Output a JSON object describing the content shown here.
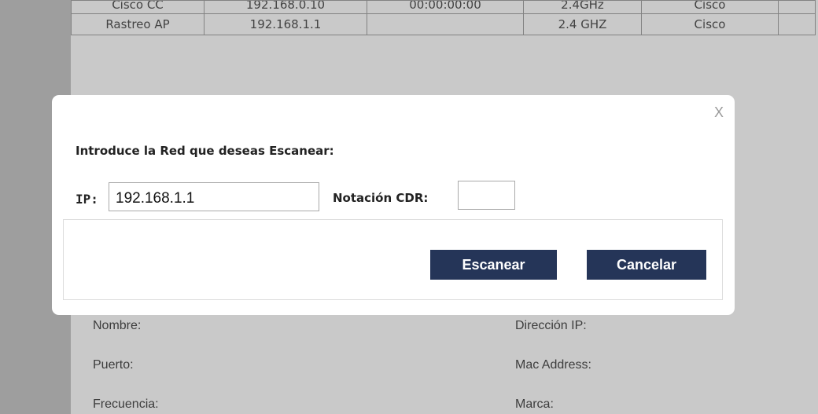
{
  "table": {
    "rows": [
      {
        "name": "Cisco CC",
        "ip": "192.168.0.10",
        "mac": "00:00:00:00",
        "freq": "2.4GHz",
        "brand": "Cisco",
        "extra": ""
      },
      {
        "name": "Rastreo AP",
        "ip": "192.168.1.1",
        "mac": "",
        "freq": "2.4 GHZ",
        "brand": "Cisco",
        "extra": ""
      }
    ]
  },
  "details": {
    "name_label": "Nombre:",
    "port_label": "Puerto:",
    "freq_label": "Frecuencia:",
    "ip_label": "Dirección IP:",
    "mac_label": "Mac Address:",
    "brand_label": "Marca:"
  },
  "modal": {
    "close_label": "X",
    "title": "Introduce la Red que deseas Escanear:",
    "ip_label": "IP:",
    "ip_value": "192.168.1.1",
    "cdr_label": "Notación CDR:",
    "cdr_value": "",
    "scan_button": "Escanear",
    "cancel_button": "Cancelar"
  },
  "colors": {
    "button_bg": "#253558",
    "overlay": "#c9c9c9"
  }
}
